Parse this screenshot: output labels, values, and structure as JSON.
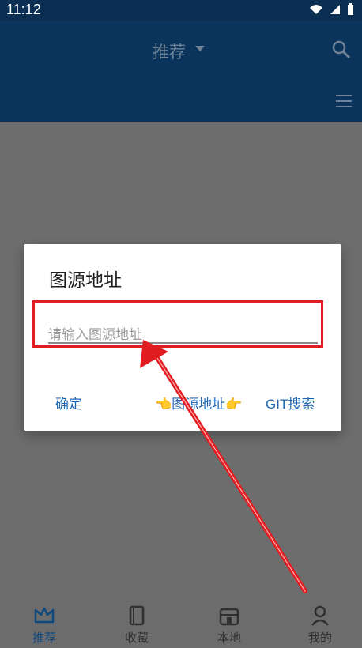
{
  "status": {
    "time": "11:12"
  },
  "appbar": {
    "title": "推荐"
  },
  "dialog": {
    "title": "图源地址",
    "placeholder": "请输入图源地址",
    "buttons": {
      "ok": "确定",
      "source": "👈图源地址👉",
      "git": "GIT搜索"
    }
  },
  "bottom_nav": [
    {
      "label": "推荐",
      "icon": "crown-icon"
    },
    {
      "label": "收藏",
      "icon": "book-icon"
    },
    {
      "label": "本地",
      "icon": "store-icon"
    },
    {
      "label": "我的",
      "icon": "person-icon"
    }
  ],
  "colors": {
    "header": "#0a345c",
    "highlight": "#e21d21",
    "button": "#1f66b3"
  }
}
